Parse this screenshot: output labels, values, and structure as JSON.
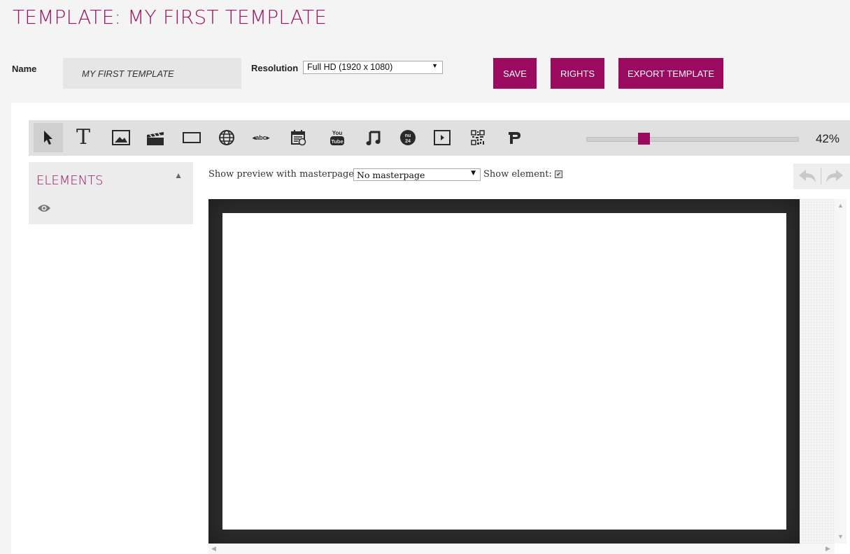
{
  "header": {
    "title": "TEMPLATE: MY FIRST TEMPLATE",
    "name_label": "Name",
    "name_value": "MY FIRST TEMPLATE",
    "resolution_label": "Resolution",
    "resolution_value": "Full HD (1920 x 1080)",
    "save_label": "SAVE",
    "rights_label": "RIGHTS",
    "export_label": "EXPORT TEMPLATE"
  },
  "toolbar": {
    "tools": [
      "select-tool",
      "text-tool",
      "image-tool",
      "video-tool",
      "shape-tool",
      "web-tool",
      "ticker-tool",
      "calendar-tool",
      "youtube-tool",
      "music-tool",
      "nu24-tool",
      "media-tool",
      "qrcode-tool",
      "parking-tool"
    ],
    "zoom_label": "42%",
    "zoom_level": 0.26
  },
  "elements_panel": {
    "title": "ELEMENTS",
    "visibility_icon": "eye-icon"
  },
  "preview": {
    "masterpage_label": "Show preview with masterpage:",
    "masterpage_value": "No masterpage",
    "show_element_label": "Show element:",
    "show_element_checked": true
  },
  "colors": {
    "accent": "#9b0a5f",
    "title": "#9b1561",
    "canvas_frame": "#2e2e2e"
  }
}
